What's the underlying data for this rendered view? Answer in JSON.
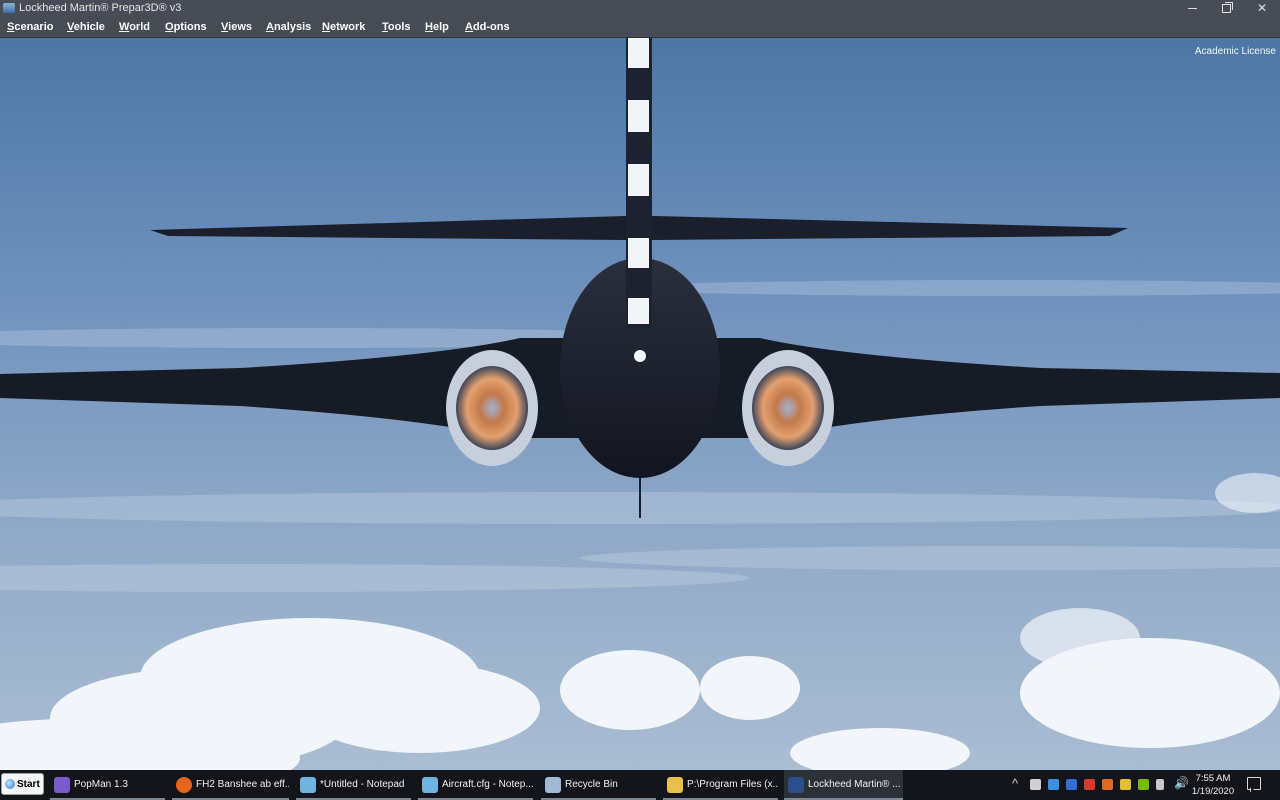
{
  "window": {
    "title": "Lockheed Martin® Prepar3D® v3",
    "controls": {
      "minimize": "minimize-icon",
      "restore": "restore-icon",
      "close": "close-icon"
    }
  },
  "menu": [
    {
      "label": "Scenario"
    },
    {
      "label": "Vehicle"
    },
    {
      "label": "World"
    },
    {
      "label": "Options"
    },
    {
      "label": "Views"
    },
    {
      "label": "Analysis"
    },
    {
      "label": "Network"
    },
    {
      "label": "Tools"
    },
    {
      "label": "Help"
    },
    {
      "label": "Add-ons"
    }
  ],
  "view": {
    "license": "Academic License"
  },
  "taskbar": {
    "start_label": "Start",
    "tasks": [
      {
        "label": "PopMan 1.3",
        "icon": "mail-icon",
        "color": "#7a5cc9"
      },
      {
        "label": "FH2 Banshee ab eff...",
        "icon": "firefox-icon",
        "color": "#e8641b"
      },
      {
        "label": "*Untitled - Notepad",
        "icon": "notepad-icon",
        "color": "#6fb3e0"
      },
      {
        "label": "Aircraft.cfg - Notep...",
        "icon": "notepad-icon",
        "color": "#6fb3e0"
      },
      {
        "label": "Recycle Bin",
        "icon": "recycle-bin-icon",
        "color": "#9fb9d6"
      },
      {
        "label": "P:\\Program Files (x...",
        "icon": "folder-icon",
        "color": "#e8c04a"
      },
      {
        "label": "Lockheed Martin® ...",
        "icon": "p3d-icon",
        "color": "#2b4f8a"
      }
    ],
    "tray_icons": [
      {
        "icon": "battery-icon",
        "color": "#d0d0d0"
      },
      {
        "icon": "dropbox-icon",
        "color": "#3d8fe0"
      },
      {
        "icon": "malwarebytes-icon",
        "color": "#2f6fd6"
      },
      {
        "icon": "app-red-icon",
        "color": "#d83a2c"
      },
      {
        "icon": "app-orange-icon",
        "color": "#e06a20"
      },
      {
        "icon": "shield-icon",
        "color": "#e0c030"
      },
      {
        "icon": "nvidia-icon",
        "color": "#76b900"
      },
      {
        "icon": "usb-icon",
        "color": "#c8c8c8"
      },
      {
        "icon": "network-icon",
        "color": "#d0d0d0"
      }
    ],
    "clock": {
      "time": "7:55 AM",
      "date": "1/19/2020"
    }
  }
}
